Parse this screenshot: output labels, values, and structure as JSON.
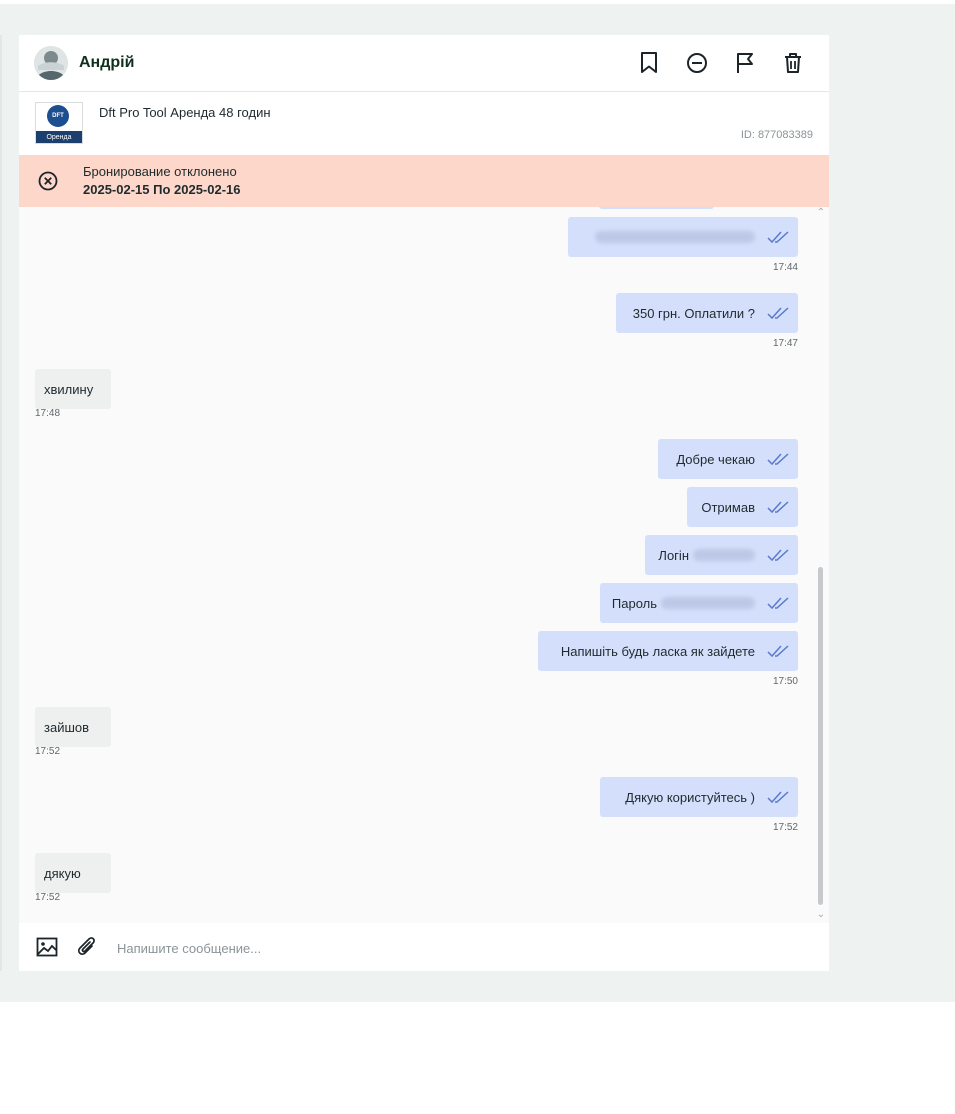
{
  "header": {
    "user_name": "Андрій",
    "icons": [
      "bookmark-icon",
      "block-icon",
      "flag-icon",
      "trash-icon"
    ]
  },
  "listing": {
    "title": "Dft Pro Tool Аренда 48 годин",
    "id_label": "ID: 877083389",
    "thumb_logo": "DFT",
    "thumb_label": "Оренда"
  },
  "status": {
    "text": "Бронирование отклонено",
    "dates": "2025-02-15 По 2025-02-16",
    "color": "#fdd7c9"
  },
  "messages": [
    {
      "dir": "out",
      "text": "",
      "time": "17:44"
    },
    {
      "dir": "out",
      "text": "350 грн. Оплатили ?",
      "time": "17:47"
    },
    {
      "dir": "in",
      "text": "хвилину",
      "time": "17:48"
    },
    {
      "dir": "out",
      "text": "Добре чекаю",
      "time": ""
    },
    {
      "dir": "out",
      "text": "Отримав",
      "time": ""
    },
    {
      "dir": "out",
      "text": "Логін",
      "time": ""
    },
    {
      "dir": "out",
      "text": "Пароль",
      "time": ""
    },
    {
      "dir": "out",
      "text": "Напишіть будь ласка як зайдете",
      "time": "17:50"
    },
    {
      "dir": "in",
      "text": "зайшов",
      "time": "17:52"
    },
    {
      "dir": "out",
      "text": "Дякую користуйтесь )",
      "time": "17:52"
    },
    {
      "dir": "in",
      "text": "дякую",
      "time": "17:52"
    }
  ],
  "composer": {
    "placeholder": "Напишите сообщение...",
    "value": ""
  },
  "colors": {
    "outgoing_bubble": "#d4e0fb",
    "incoming_bubble": "#eeefef",
    "ticks": "#5b78c9",
    "accent_text": "#10301f"
  }
}
